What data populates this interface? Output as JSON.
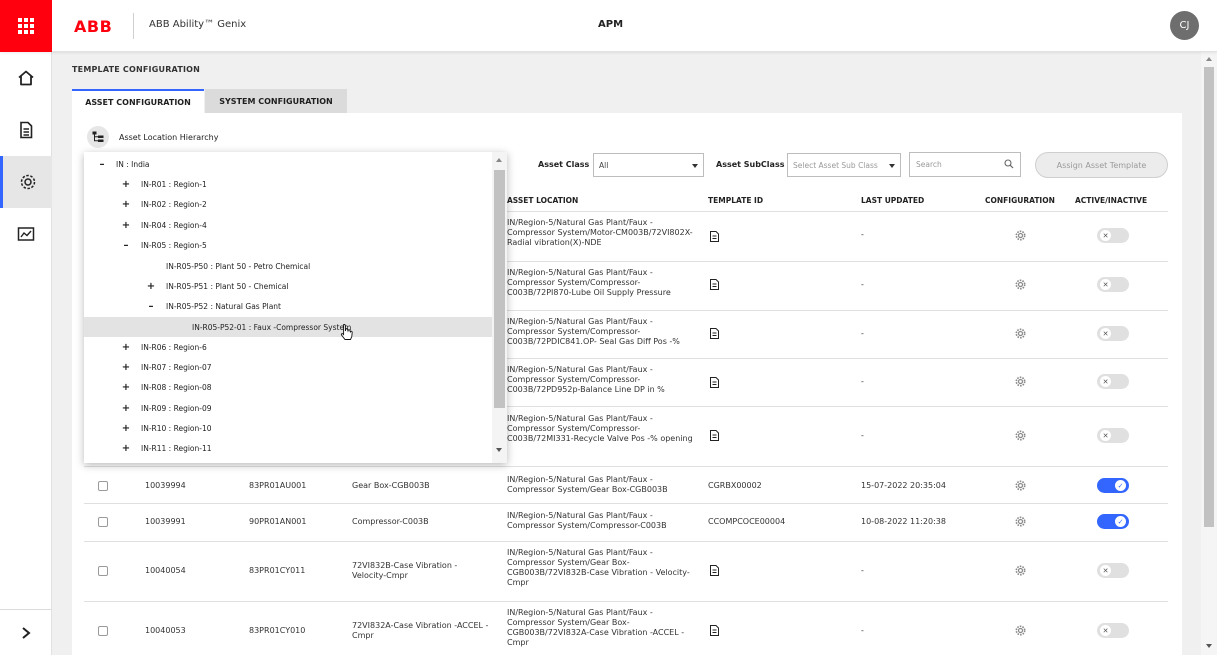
{
  "header": {
    "logo": "ABB",
    "product": "ABB Ability™ Genix",
    "app_title": "APM",
    "avatar_initials": "CJ"
  },
  "nav": {
    "items": [
      {
        "icon": "home-icon"
      },
      {
        "icon": "document-icon"
      },
      {
        "icon": "settings-configuration-icon",
        "active": true
      },
      {
        "icon": "dashboard-chart-icon"
      }
    ],
    "expand_icon": "chevron-right-icon"
  },
  "page": {
    "title": "TEMPLATE CONFIGURATION",
    "tabs": [
      {
        "label": "ASSET CONFIGURATION",
        "active": true
      },
      {
        "label": "SYSTEM CONFIGURATION",
        "active": false
      }
    ],
    "hierarchy_label": "Asset Location Hierarchy"
  },
  "filters": {
    "asset_class_label": "Asset Class",
    "asset_class_value": "All",
    "asset_subclass_label": "Asset SubClass",
    "asset_subclass_placeholder": "Select Asset Sub Class",
    "search_placeholder": "Search",
    "assign_button": "Assign Asset Template"
  },
  "table": {
    "columns": {
      "location": "ASSET LOCATION",
      "template_id": "TEMPLATE ID",
      "last_updated": "LAST UPDATED",
      "configuration": "CONFIGURATION",
      "active": "ACTIVE/INACTIVE"
    },
    "rows": [
      {
        "id": "",
        "code": "",
        "name": "",
        "location": "IN/Region-5/Natural Gas Plant/Faux -Compressor System/Motor-CM003B/72VI802X-Radial vibration(X)-NDE",
        "template": "",
        "updated": "-",
        "active": false
      },
      {
        "id": "",
        "code": "",
        "name": "",
        "location": "IN/Region-5/Natural Gas Plant/Faux -Compressor System/Compressor-C003B/72PI870-Lube Oil Supply Pressure",
        "template": "",
        "updated": "-",
        "active": false
      },
      {
        "id": "",
        "code": "",
        "name": "",
        "location": "IN/Region-5/Natural Gas Plant/Faux -Compressor System/Compressor-C003B/72PDIC841.OP- Seal Gas Diff Pos -%",
        "template": "",
        "updated": "-",
        "active": false
      },
      {
        "id": "",
        "code": "",
        "name": "",
        "location": "IN/Region-5/Natural Gas Plant/Faux -Compressor System/Compressor-C003B/72PD952p-Balance Line DP in %",
        "template": "",
        "updated": "-",
        "active": false
      },
      {
        "id": "",
        "code": "",
        "name": "",
        "location": "IN/Region-5/Natural Gas Plant/Faux -Compressor System/Compressor-C003B/72MI331-Recycle Valve Pos -% opening",
        "template": "",
        "updated": "-",
        "active": false
      },
      {
        "id": "10039994",
        "code": "83PR01AU001",
        "name": "Gear Box-CGB003B",
        "location": "IN/Region-5/Natural Gas Plant/Faux -Compressor System/Gear Box-CGB003B",
        "template": "CGRBX00002",
        "updated": "15-07-2022 20:35:04",
        "active": true
      },
      {
        "id": "10039991",
        "code": "90PR01AN001",
        "name": "Compressor-C003B",
        "location": "IN/Region-5/Natural Gas Plant/Faux -Compressor System/Compressor-C003B",
        "template": "CCOMPCOCE00004",
        "updated": "10-08-2022 11:20:38",
        "active": true
      },
      {
        "id": "10040054",
        "code": "83PR01CY011",
        "name": "72VI832B-Case Vibration - Velocity-Cmpr",
        "location": "IN/Region-5/Natural Gas Plant/Faux -Compressor System/Gear Box-CGB003B/72VI832B-Case Vibration - Velocity-Cmpr",
        "template": "",
        "updated": "-",
        "active": false
      },
      {
        "id": "10040053",
        "code": "83PR01CY010",
        "name": "72VI832A-Case Vibration -ACCEL -Cmpr",
        "location": "IN/Region-5/Natural Gas Plant/Faux -Compressor System/Gear Box-CGB003B/72VI832A-Case Vibration -ACCEL -Cmpr",
        "template": "",
        "updated": "-",
        "active": false
      }
    ]
  },
  "tree": {
    "items": [
      {
        "sign": "–",
        "label": "IN : India",
        "level": 0
      },
      {
        "sign": "+",
        "label": "IN-R01 : Region-1",
        "level": 1
      },
      {
        "sign": "+",
        "label": "IN-R02 : Region-2",
        "level": 1
      },
      {
        "sign": "+",
        "label": "IN-R04 : Region-4",
        "level": 1
      },
      {
        "sign": "–",
        "label": "IN-R05 : Region-5",
        "level": 1
      },
      {
        "sign": "",
        "label": "IN-R05-P50 : Plant 50 - Petro Chemical",
        "level": 2
      },
      {
        "sign": "+",
        "label": "IN-R05-P51 : Plant 50 - Chemical",
        "level": 2
      },
      {
        "sign": "–",
        "label": "IN-R05-P52 : Natural Gas Plant",
        "level": 2
      },
      {
        "sign": "",
        "label": "IN-R05-P52-01 : Faux -Compressor System",
        "level": 3,
        "highlighted": true
      },
      {
        "sign": "+",
        "label": "IN-R06 : Region-6",
        "level": 1
      },
      {
        "sign": "+",
        "label": "IN-R07 : Region-07",
        "level": 1
      },
      {
        "sign": "+",
        "label": "IN-R08 : Region-08",
        "level": 1
      },
      {
        "sign": "+",
        "label": "IN-R09 : Region-09",
        "level": 1
      },
      {
        "sign": "+",
        "label": "IN-R10 : Region-10",
        "level": 1
      },
      {
        "sign": "+",
        "label": "IN-R11 : Region-11",
        "level": 1
      }
    ]
  },
  "colors": {
    "brand_red": "#ff000f",
    "accent_blue": "#3366ff"
  }
}
